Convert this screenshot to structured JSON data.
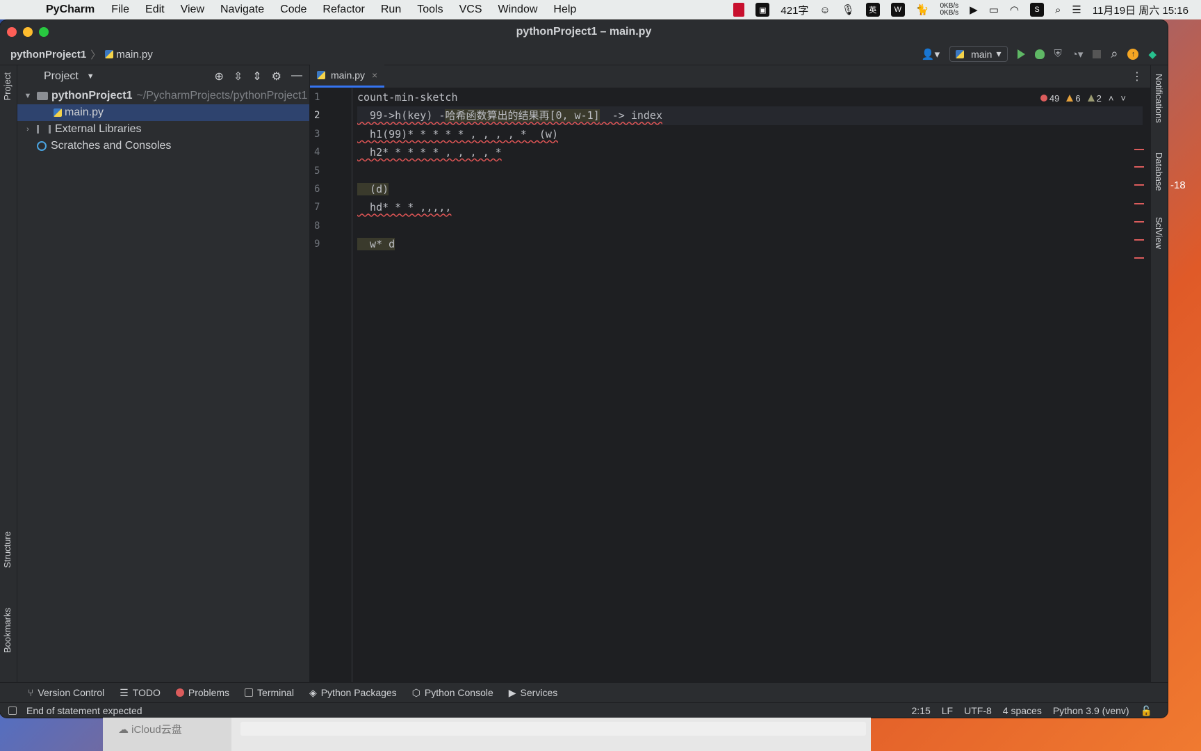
{
  "menubar": {
    "app_name": "PyCharm",
    "items": [
      "File",
      "Edit",
      "View",
      "Navigate",
      "Code",
      "Refactor",
      "Run",
      "Tools",
      "VCS",
      "Window",
      "Help"
    ],
    "word_count": "421字",
    "input_method": "英",
    "net_up": "0KB/s",
    "net_down": "0KB/s",
    "datetime": "11月19日 周六  15:16"
  },
  "window": {
    "title": "pythonProject1 – main.py"
  },
  "navbar": {
    "project": "pythonProject1",
    "file": "main.py",
    "run_config": "main"
  },
  "project_panel": {
    "title": "Project",
    "root_name": "pythonProject1",
    "root_path": "~/PycharmProjects/pythonProject1",
    "file": "main.py",
    "external_libraries": "External Libraries",
    "scratches": "Scratches and Consoles"
  },
  "editor": {
    "tab_label": "main.py",
    "line_numbers": [
      "1",
      "2",
      "3",
      "4",
      "5",
      "6",
      "7",
      "8",
      "9"
    ],
    "lines": [
      "count-min-sketch",
      "  99->h(key) -",
      "  h1(99)* * * * * , , , , *  (w)",
      "  h2* * * * * , , , , *",
      "",
      "  (d)",
      "  hd* * * ,,,,,",
      "",
      "  w* d"
    ],
    "line2_comment": "哈希函数算出的结果再[0, w-1]",
    "line2_tail": "  -> index",
    "errors": "49",
    "warnings": "6",
    "weak_warnings": "2",
    "side_label": "-18"
  },
  "right_stripe": {
    "notifications": "Notifications",
    "database": "Database",
    "sciview": "SciView"
  },
  "left_stripe": {
    "project": "Project",
    "structure": "Structure",
    "bookmarks": "Bookmarks"
  },
  "tool_windows": [
    "Version Control",
    "TODO",
    "Problems",
    "Terminal",
    "Python Packages",
    "Python Console",
    "Services"
  ],
  "status": {
    "message": "End of statement expected",
    "position": "2:15",
    "line_sep": "LF",
    "encoding": "UTF-8",
    "indent": "4 spaces",
    "interpreter": "Python 3.9 (venv)"
  },
  "finder": {
    "icloud": "iCloud云盘"
  }
}
